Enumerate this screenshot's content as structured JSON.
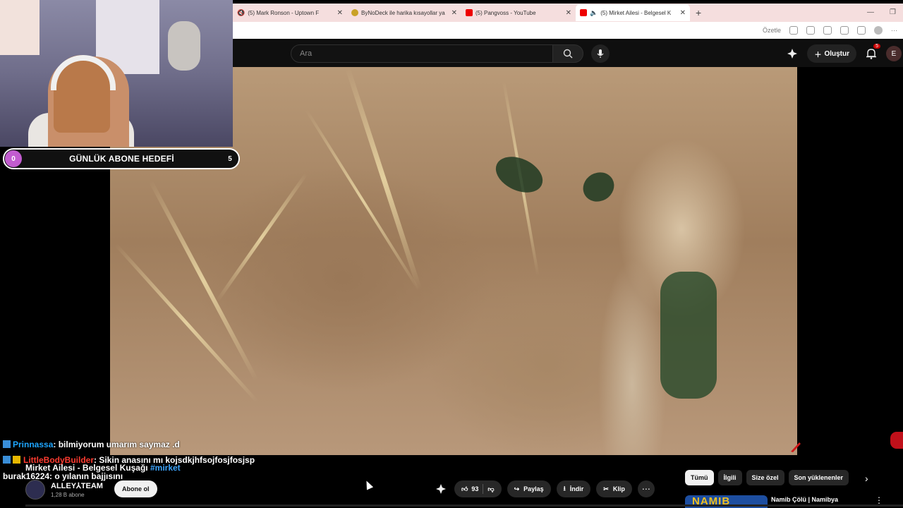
{
  "browser": {
    "tabs": [
      {
        "title": "(5) Mark Ronson - Uptown F",
        "favicon": "youtube",
        "muted": true
      },
      {
        "title": "ByNoDeck ile harika kısayollar ya",
        "favicon": "bynodeck",
        "muted": false
      },
      {
        "title": "(5) Pangvoss - YouTube",
        "favicon": "youtube",
        "muted": false
      },
      {
        "title": "(5) Mirket Ailesi - Belgesel K",
        "favicon": "youtube",
        "muted": true,
        "active": true
      }
    ],
    "toolbar_label": "Özetle"
  },
  "youtube": {
    "search_placeholder": "Ara",
    "create_label": "Oluştur",
    "notification_count": "5",
    "user_initial": "E"
  },
  "stream": {
    "goal": {
      "current": "0",
      "label": "GÜNLÜK ABONE HEDEFİ",
      "target": "5"
    },
    "chat": [
      {
        "user": "Prinnassa",
        "text": ": bilmiyorum umarım saymaz .d"
      },
      {
        "user": "LittleBodyBuilder",
        "text": ": Sikin anasını mı kojsdkjhfsojfosjfosjsp"
      },
      {
        "user": "burak16224",
        "text": ": o yılanın bajjısını"
      }
    ]
  },
  "video": {
    "title": "Mirket Ailesi - Belgesel Kuşağı",
    "hashtag": "#mirket",
    "channel_name": "ALLEY⅄TEAM",
    "channel_subs": "1,28 B abone",
    "subscribe_label": "Abone ol",
    "likes": "93",
    "share_label": "Paylaş",
    "download_label": "İndir",
    "clip_label": "Klip"
  },
  "sidebar": {
    "chips": [
      "Tümü",
      "İlgili",
      "Size özel",
      "Son yüklenenler"
    ],
    "first_related": {
      "thumb_text": "NAMIB",
      "title": "Namib Çölü | Namibya"
    }
  },
  "colors": {
    "youtube_red": "#ff0000",
    "link_blue": "#3ea6ff",
    "goal_accent": "#c25ccf"
  }
}
